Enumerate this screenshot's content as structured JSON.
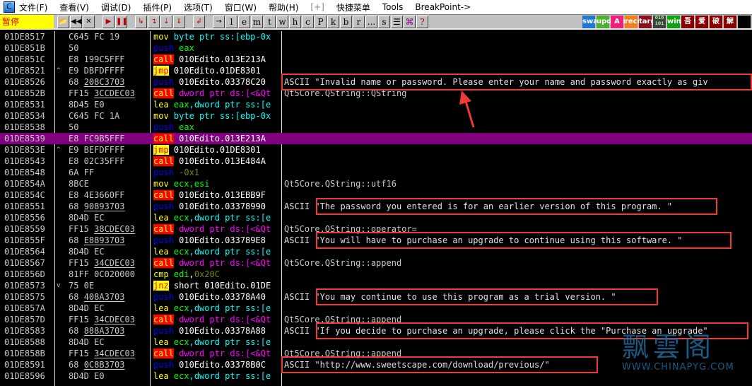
{
  "menubar": {
    "items": [
      "文件(F)",
      "查看(V)",
      "调试(D)",
      "插件(P)",
      "选项(T)",
      "窗口(W)",
      "帮助(H)",
      "[+]",
      "快捷菜单",
      "Tools",
      "BreakPoint->"
    ]
  },
  "toolbar": {
    "status": "暂停",
    "buttons": [
      "open",
      "rewind",
      "close",
      "run",
      "pause",
      "step-into",
      "step-over",
      "trace-into",
      "trace-over",
      "execute-till-return",
      "go-to"
    ],
    "letters": [
      "l",
      "e",
      "m",
      "t",
      "w",
      "h",
      "c",
      "P",
      "k",
      "b",
      "r",
      "...",
      "s"
    ],
    "extra": [
      "list",
      "tree",
      "?"
    ],
    "plugins": [
      "swap",
      "updown",
      "A",
      "record",
      "target",
      "010 101",
      "window",
      "吾",
      "爱",
      "破",
      "解",
      ""
    ]
  },
  "rows": [
    {
      "addr": "01DE8517",
      "mark": "",
      "hex": [
        "C645 FC 19",
        ""
      ],
      "dis": [
        [
          "mov",
          "mov"
        ],
        [
          "cyan",
          " byte ptr ss:[ebp-0x"
        ]
      ],
      "cmt": ""
    },
    {
      "addr": "01DE851B",
      "mark": "",
      "hex": [
        "50",
        ""
      ],
      "dis": [
        [
          "push",
          "push"
        ],
        [
          "green",
          " eax"
        ]
      ],
      "cmt": ""
    },
    {
      "addr": "01DE851C",
      "mark": "",
      "hex": [
        "E8 199C5FFF",
        ""
      ],
      "dis": [
        [
          "call",
          "call"
        ],
        [
          "white",
          " 010Edito.013E213A"
        ]
      ],
      "cmt": ""
    },
    {
      "addr": "01DE8521",
      "mark": "^",
      "hex": [
        "E9 DBFDFFFF",
        ""
      ],
      "dis": [
        [
          "jmp",
          "jmp"
        ],
        [
          "white",
          " 010Edito.01DE8301"
        ]
      ],
      "cmt": ""
    },
    {
      "addr": "01DE8526",
      "mark": "",
      "hex": [
        "68 ",
        "208C3703"
      ],
      "dis": [
        [
          "push",
          "push"
        ],
        [
          "white",
          " 010Edito.03378C20"
        ]
      ],
      "cmt": "ASCII \"Invalid name or password. Please enter your name and password exactly as giv"
    },
    {
      "addr": "01DE852B",
      "mark": "",
      "hex": [
        "FF15 ",
        "3CCDEC03"
      ],
      "dis": [
        [
          "call",
          "call"
        ],
        [
          "mag",
          " dword ptr ds:[<&Qt"
        ]
      ],
      "cmt": "Qt5Core.QString::QString"
    },
    {
      "addr": "01DE8531",
      "mark": "",
      "hex": [
        "8D45 E0",
        ""
      ],
      "dis": [
        [
          "mov",
          "lea"
        ],
        [
          "green",
          " eax"
        ],
        [
          "cyan",
          ",dword ptr ss:[e"
        ]
      ],
      "cmt": ""
    },
    {
      "addr": "01DE8534",
      "mark": "",
      "hex": [
        "C645 FC 1A",
        ""
      ],
      "dis": [
        [
          "mov",
          "mov"
        ],
        [
          "cyan",
          " byte ptr ss:[ebp-0x"
        ]
      ],
      "cmt": ""
    },
    {
      "addr": "01DE8538",
      "mark": "",
      "hex": [
        "50",
        ""
      ],
      "dis": [
        [
          "push",
          "push"
        ],
        [
          "green",
          " eax"
        ]
      ],
      "cmt": ""
    },
    {
      "addr": "01DE8539",
      "mark": "",
      "hex": [
        "E8 FC9B5FFF",
        ""
      ],
      "dis": [
        [
          "call",
          "call"
        ],
        [
          "white",
          " 010Edito.013E213A"
        ]
      ],
      "cmt": "",
      "sel": true
    },
    {
      "addr": "01DE853E",
      "mark": "^",
      "hex": [
        "E9 BEFDFFFF",
        ""
      ],
      "dis": [
        [
          "jmp",
          "jmp"
        ],
        [
          "white",
          " 010Edito.01DE8301"
        ]
      ],
      "cmt": ""
    },
    {
      "addr": "01DE8543",
      "mark": "",
      "hex": [
        "E8 02C35FFF",
        ""
      ],
      "dis": [
        [
          "call",
          "call"
        ],
        [
          "white",
          " 010Edito.013E484A"
        ]
      ],
      "cmt": ""
    },
    {
      "addr": "01DE8548",
      "mark": "",
      "hex": [
        "6A FF",
        ""
      ],
      "dis": [
        [
          "push",
          "push"
        ],
        [
          "olive",
          " -0x1"
        ]
      ],
      "cmt": ""
    },
    {
      "addr": "01DE854A",
      "mark": "",
      "hex": [
        "8BCE",
        ""
      ],
      "dis": [
        [
          "mov",
          "mov"
        ],
        [
          "green",
          " ecx,esi"
        ]
      ],
      "cmt": "Qt5Core.QString::utf16"
    },
    {
      "addr": "01DE854C",
      "mark": "",
      "hex": [
        "E8 4E3660FF",
        ""
      ],
      "dis": [
        [
          "call",
          "call"
        ],
        [
          "white",
          " 010Edito.013EBB9F"
        ]
      ],
      "cmt": ""
    },
    {
      "addr": "01DE8551",
      "mark": "",
      "hex": [
        "68 ",
        "90893703"
      ],
      "dis": [
        [
          "push",
          "push"
        ],
        [
          "white",
          " 010Edito.03378990"
        ]
      ],
      "cmt": "ASCII \"The password you entered is for an earlier version of this program. \""
    },
    {
      "addr": "01DE8556",
      "mark": "",
      "hex": [
        "8D4D EC",
        ""
      ],
      "dis": [
        [
          "mov",
          "lea"
        ],
        [
          "green",
          " ecx"
        ],
        [
          "cyan",
          ",dword ptr ss:[e"
        ]
      ],
      "cmt": ""
    },
    {
      "addr": "01DE8559",
      "mark": "",
      "hex": [
        "FF15 ",
        "38CDEC03"
      ],
      "dis": [
        [
          "call",
          "call"
        ],
        [
          "mag",
          " dword ptr ds:[<&Qt"
        ]
      ],
      "cmt": "Qt5Core.QString::operator="
    },
    {
      "addr": "01DE855F",
      "mark": "",
      "hex": [
        "68 ",
        "E8893703"
      ],
      "dis": [
        [
          "push",
          "push"
        ],
        [
          "white",
          " 010Edito.033789E8"
        ]
      ],
      "cmt": "ASCII \"You will have to purchase an upgrade to continue using this software. \""
    },
    {
      "addr": "01DE8564",
      "mark": "",
      "hex": [
        "8D4D EC",
        ""
      ],
      "dis": [
        [
          "mov",
          "lea"
        ],
        [
          "green",
          " ecx"
        ],
        [
          "cyan",
          ",dword ptr ss:[e"
        ]
      ],
      "cmt": ""
    },
    {
      "addr": "01DE8567",
      "mark": "",
      "hex": [
        "FF15 ",
        "34CDEC03"
      ],
      "dis": [
        [
          "call",
          "call"
        ],
        [
          "mag",
          " dword ptr ds:[<&Qt"
        ]
      ],
      "cmt": "Qt5Core.QString::append"
    },
    {
      "addr": "01DE856D",
      "mark": "",
      "hex": [
        "81FF 0C020000",
        ""
      ],
      "dis": [
        [
          "mov",
          "cmp"
        ],
        [
          "green",
          " edi"
        ],
        [
          "white",
          ","
        ],
        [
          "olive",
          "0x20C"
        ]
      ],
      "cmt": ""
    },
    {
      "addr": "01DE8573",
      "mark": "v",
      "hex": [
        "75 0E",
        ""
      ],
      "dis": [
        [
          "jmp",
          "jnz"
        ],
        [
          "white",
          " short 010Edito.01DE"
        ]
      ],
      "cmt": ""
    },
    {
      "addr": "01DE8575",
      "mark": "",
      "hex": [
        "68 ",
        "408A3703"
      ],
      "dis": [
        [
          "push",
          "push"
        ],
        [
          "white",
          " 010Edito.03378A40"
        ]
      ],
      "cmt": "ASCII \"You may continue to use this program as a trial version. \""
    },
    {
      "addr": "01DE857A",
      "mark": "",
      "hex": [
        "8D4D EC",
        ""
      ],
      "dis": [
        [
          "mov",
          "lea"
        ],
        [
          "green",
          " ecx"
        ],
        [
          "cyan",
          ",dword ptr ss:[e"
        ]
      ],
      "cmt": ""
    },
    {
      "addr": "01DE857D",
      "mark": "",
      "hex": [
        "FF15 ",
        "34CDEC03"
      ],
      "dis": [
        [
          "call",
          "call"
        ],
        [
          "mag",
          " dword ptr ds:[<&Qt"
        ]
      ],
      "cmt": "Qt5Core.QString::append"
    },
    {
      "addr": "01DE8583",
      "mark": "",
      "hex": [
        "68 ",
        "888A3703"
      ],
      "dis": [
        [
          "push",
          "push"
        ],
        [
          "white",
          " 010Edito.03378A88"
        ]
      ],
      "cmt": "ASCII \"If you decide to purchase an upgrade, please click the \"Purchase an upgrade\""
    },
    {
      "addr": "01DE8588",
      "mark": "",
      "hex": [
        "8D4D EC",
        ""
      ],
      "dis": [
        [
          "mov",
          "lea"
        ],
        [
          "green",
          " ecx"
        ],
        [
          "cyan",
          ",dword ptr ss:[e"
        ]
      ],
      "cmt": ""
    },
    {
      "addr": "01DE858B",
      "mark": "",
      "hex": [
        "FF15 ",
        "34CDEC03"
      ],
      "dis": [
        [
          "call",
          "call"
        ],
        [
          "mag",
          " dword ptr ds:[<&Qt"
        ]
      ],
      "cmt": "Qt5Core.QString::append"
    },
    {
      "addr": "01DE8591",
      "mark": "",
      "hex": [
        "68 ",
        "0C8B3703"
      ],
      "dis": [
        [
          "push",
          "push"
        ],
        [
          "white",
          " 010Edito.03378B0C"
        ]
      ],
      "cmt": "ASCII \"http://www.sweetscape.com/download/previous/\""
    },
    {
      "addr": "01DE8596",
      "mark": "",
      "hex": [
        "8D4D E0",
        ""
      ],
      "dis": [
        [
          "mov",
          "lea"
        ],
        [
          "green",
          " ecx"
        ],
        [
          "cyan",
          ",dword ptr ss:[e"
        ]
      ],
      "cmt": ""
    }
  ],
  "watermark": {
    "cn": "飘雲阁",
    "url": "WWW.CHINAPYG.COM"
  },
  "colors": {
    "selection": "#800080",
    "highlight_box": "#f03a3a",
    "status_bg": "#ffff00"
  }
}
